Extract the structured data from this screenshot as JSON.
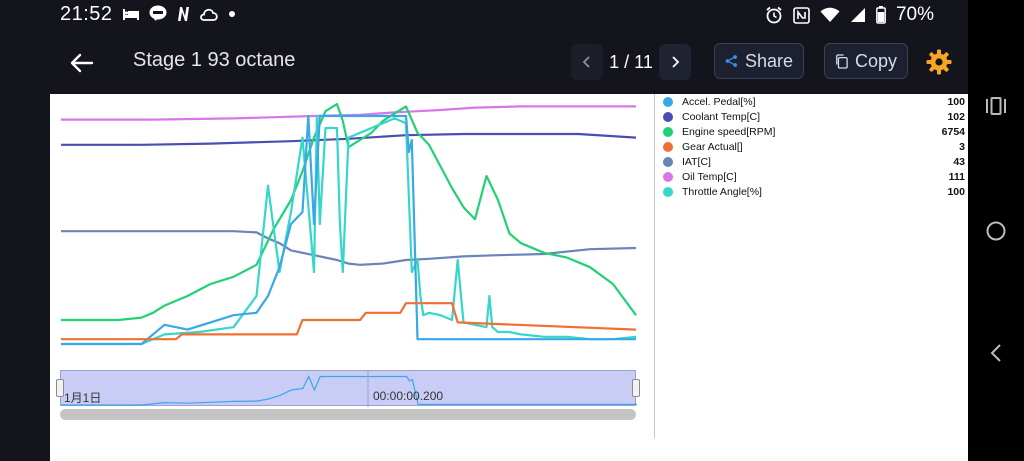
{
  "status_bar": {
    "time": "21:52",
    "battery": "70%",
    "left_icons": [
      "bed-icon",
      "line-app-icon",
      "n-app-icon",
      "cloud-icon",
      "dot-icon"
    ],
    "right_icons": [
      "alarm-icon",
      "nfc-icon",
      "wifi-icon",
      "signal-icon",
      "battery-icon"
    ]
  },
  "header": {
    "title": "Stage 1 93 octane",
    "pager": "1 / 11",
    "share_label": "Share",
    "copy_label": "Copy",
    "accent_color": "#f5a623"
  },
  "legend": [
    {
      "name": "Accel. Pedal[%]",
      "value": "100",
      "color": "#3aa7e8"
    },
    {
      "name": "Coolant Temp[C]",
      "value": "102",
      "color": "#4b4db0"
    },
    {
      "name": "Engine speed[RPM]",
      "value": "6754",
      "color": "#22d173"
    },
    {
      "name": "Gear Actual[]",
      "value": "3",
      "color": "#f07034"
    },
    {
      "name": "IAT[C]",
      "value": "43",
      "color": "#6a84b8"
    },
    {
      "name": "Oil Temp[C]",
      "value": "111",
      "color": "#d778e6"
    },
    {
      "name": "Throttle Angle[%]",
      "value": "100",
      "color": "#36d6c8"
    }
  ],
  "navigator": {
    "start_label": "1月1日",
    "mid_label": "00:00:00.200"
  },
  "chart_data": {
    "type": "line",
    "x_range": [
      0,
      100
    ],
    "normalized_y": true,
    "grid": false,
    "legend_position": "right",
    "series": [
      {
        "name": "Oil Temp[C]",
        "color": "#d778e6",
        "x": [
          0,
          16,
          30,
          44,
          52,
          58,
          62,
          66,
          72,
          80,
          100
        ],
        "y": [
          0.935,
          0.935,
          0.94,
          0.95,
          0.955,
          0.965,
          0.97,
          0.975,
          0.985,
          0.99,
          0.99
        ]
      },
      {
        "name": "Coolant Temp[C]",
        "color": "#4b4db0",
        "x": [
          0,
          14,
          26,
          40,
          50,
          60,
          70,
          80,
          90,
          100
        ],
        "y": [
          0.83,
          0.83,
          0.835,
          0.845,
          0.855,
          0.87,
          0.875,
          0.875,
          0.875,
          0.86
        ]
      },
      {
        "name": "IAT[C]",
        "color": "#6a84b8",
        "x": [
          0,
          30,
          34,
          36,
          38,
          40,
          44,
          48,
          50,
          52,
          56,
          60,
          64,
          70,
          76,
          84,
          92,
          100
        ],
        "y": [
          0.47,
          0.47,
          0.465,
          0.44,
          0.42,
          0.39,
          0.37,
          0.35,
          0.335,
          0.33,
          0.335,
          0.35,
          0.355,
          0.365,
          0.37,
          0.375,
          0.395,
          0.4
        ]
      },
      {
        "name": "Engine speed[RPM]",
        "color": "#22d173",
        "x": [
          0,
          10,
          14,
          16,
          18,
          22,
          26,
          30,
          34,
          37,
          40,
          42,
          44,
          46,
          48,
          49,
          50,
          52,
          54,
          56,
          58,
          60,
          62,
          64,
          66,
          68,
          70,
          72,
          74,
          76,
          78,
          80,
          84,
          88,
          92,
          96,
          100
        ],
        "y": [
          0.1,
          0.1,
          0.11,
          0.13,
          0.16,
          0.2,
          0.25,
          0.28,
          0.33,
          0.48,
          0.6,
          0.72,
          0.86,
          0.97,
          1.0,
          0.93,
          0.82,
          0.85,
          0.88,
          0.93,
          0.96,
          0.99,
          0.88,
          0.83,
          0.74,
          0.65,
          0.57,
          0.52,
          0.7,
          0.6,
          0.46,
          0.42,
          0.38,
          0.36,
          0.32,
          0.25,
          0.12
        ]
      },
      {
        "name": "Throttle Angle[%]",
        "color": "#36d6c8",
        "x": [
          0,
          14,
          18,
          24,
          30,
          34,
          36,
          38,
          40,
          42,
          44,
          44.5,
          45,
          46,
          48,
          48.5,
          49,
          50,
          52,
          54,
          56,
          58,
          60,
          61,
          62,
          62.5,
          63,
          64,
          66,
          67,
          68,
          69,
          70,
          72,
          74,
          74.5,
          75,
          76,
          78,
          80,
          84,
          88,
          92,
          96,
          100
        ],
        "y": [
          0,
          0,
          0.04,
          0.05,
          0.07,
          0.2,
          0.66,
          0.3,
          0.55,
          0.86,
          0.3,
          0.95,
          0.5,
          0.9,
          0.9,
          0.5,
          0.3,
          0.86,
          0.88,
          0.9,
          0.92,
          0.94,
          0.92,
          0.3,
          0.35,
          0.2,
          0.12,
          0.13,
          0.12,
          0.11,
          0.1,
          0.35,
          0.09,
          0.08,
          0.07,
          0.2,
          0.07,
          0.05,
          0.05,
          0.04,
          0.03,
          0.03,
          0.02,
          0.02,
          0.03
        ]
      },
      {
        "name": "Accel. Pedal[%]",
        "color": "#3aa7e8",
        "x": [
          0,
          14,
          18,
          22,
          26,
          30,
          34,
          36,
          38,
          40,
          42,
          43,
          44,
          45,
          46,
          48,
          52,
          56,
          60,
          60.5,
          61,
          62,
          66,
          70,
          74,
          80,
          86,
          92,
          100
        ],
        "y": [
          0,
          0,
          0.08,
          0.06,
          0.09,
          0.12,
          0.13,
          0.2,
          0.32,
          0.5,
          0.55,
          0.95,
          0.5,
          0.95,
          0.95,
          0.95,
          0.95,
          0.95,
          0.95,
          0.8,
          0.85,
          0.02,
          0.02,
          0.02,
          0.02,
          0.02,
          0.02,
          0.02,
          0.02
        ]
      },
      {
        "name": "Gear Actual[]",
        "color": "#f07034",
        "x": [
          0,
          20,
          21,
          41,
          42,
          52,
          53,
          59,
          60,
          68,
          69,
          100
        ],
        "y": [
          0.02,
          0.02,
          0.04,
          0.04,
          0.1,
          0.1,
          0.13,
          0.13,
          0.17,
          0.17,
          0.09,
          0.06
        ]
      }
    ]
  }
}
